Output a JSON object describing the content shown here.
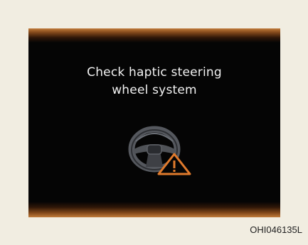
{
  "display": {
    "message_line1": "Check haptic steering",
    "message_line2": "wheel system"
  },
  "icons": {
    "steering_wheel": "steering-wheel-icon",
    "warning": "warning-triangle-icon"
  },
  "colors": {
    "background": "#f1ede1",
    "screen": "#050505",
    "glow": "#c27c3a",
    "text": "#f2f2f2",
    "wheel": "#4a4d52",
    "warning": "#e07a2c"
  },
  "caption": "OHI046135L"
}
